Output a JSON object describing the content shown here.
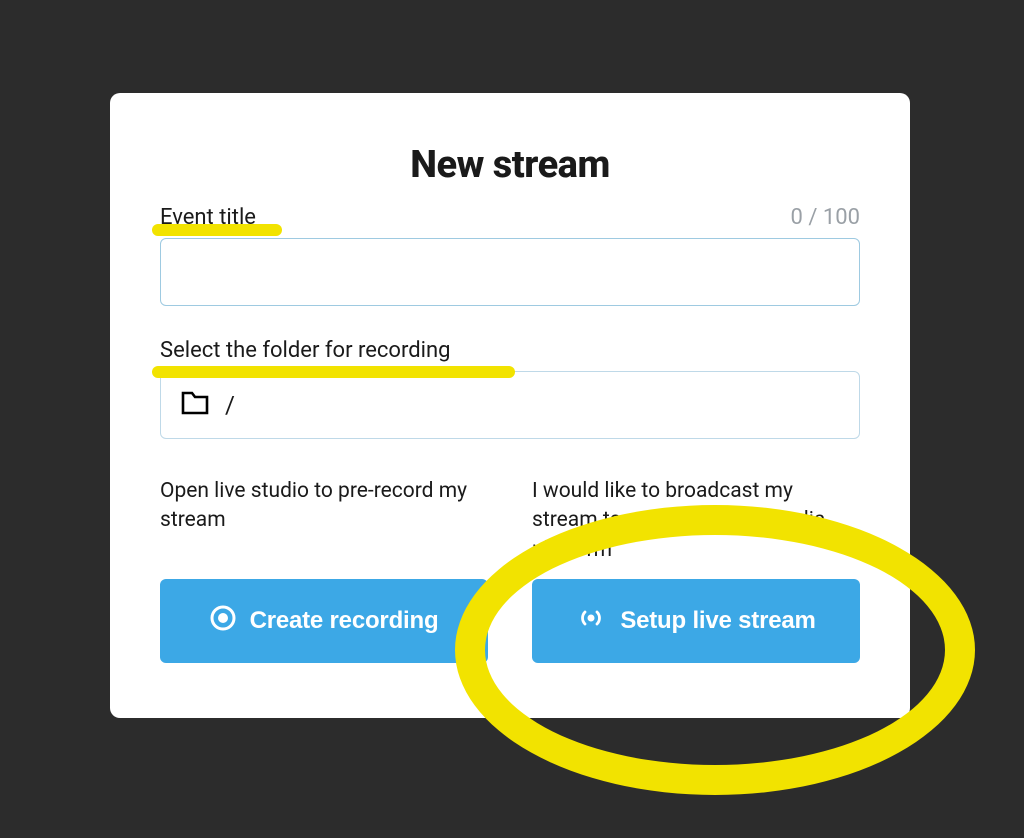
{
  "modal": {
    "title": "New stream",
    "event_title": {
      "label": "Event title",
      "counter": "0 / 100",
      "value": ""
    },
    "folder": {
      "label": "Select the folder for recording",
      "path": "/"
    },
    "options": {
      "record": {
        "description": "Open live studio to pre-record my stream",
        "button_label": "Create recording"
      },
      "live": {
        "description": "I would like to broadcast my stream to external social media platform",
        "button_label": "Setup live stream"
      }
    }
  }
}
